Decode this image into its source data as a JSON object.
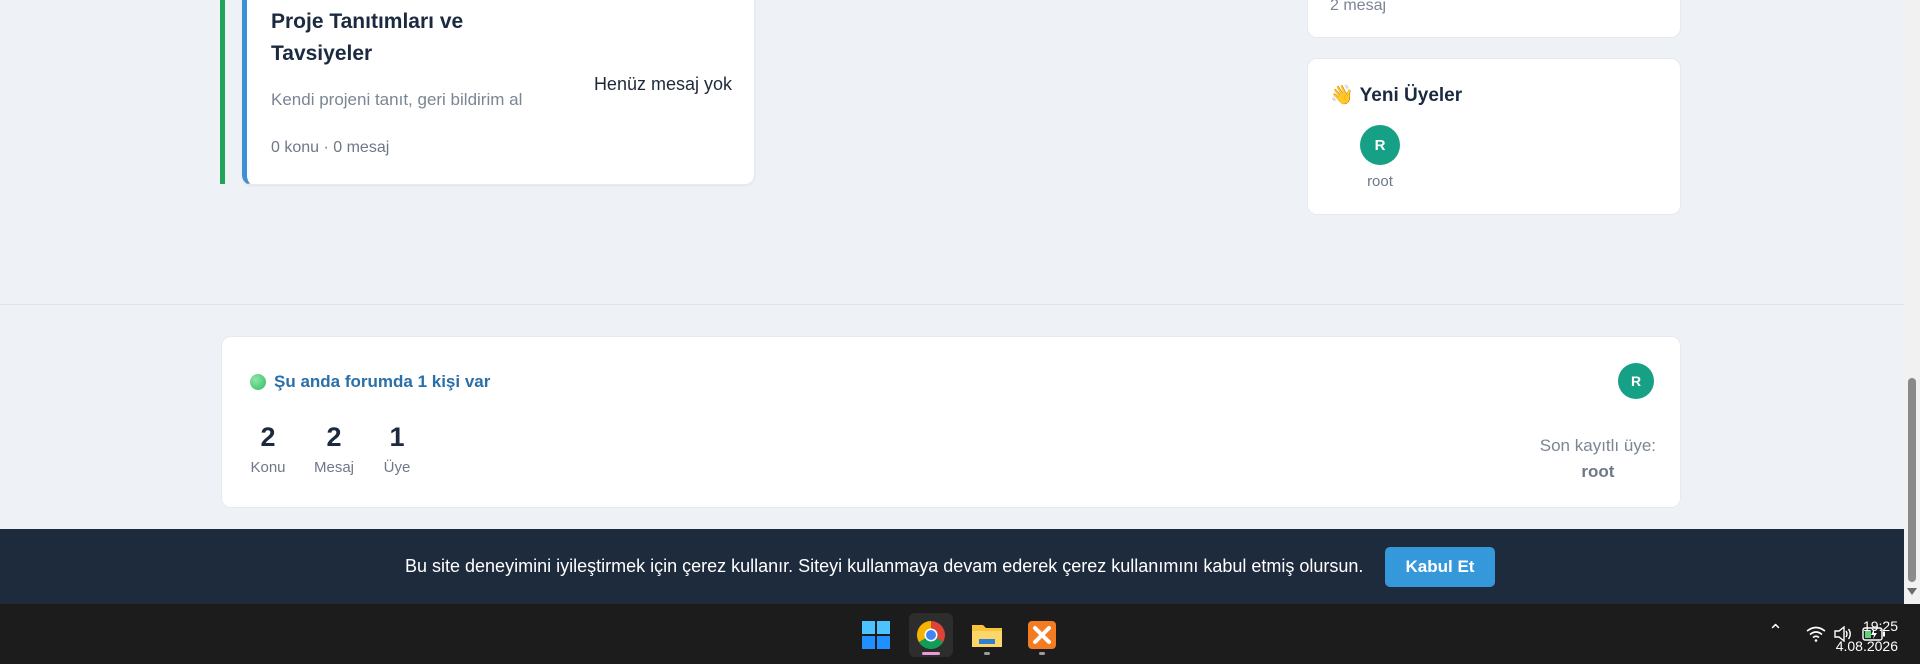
{
  "forum": {
    "title": "Proje Tanıtımları ve Tavsiyeler",
    "description": "Kendi projeni tanıt, geri bildirim al",
    "stats": "0 konu · 0 mesaj",
    "last_message": "Henüz mesaj yok"
  },
  "sidebar": {
    "top_card_text": "2 mesaj",
    "new_members": {
      "title": "Yeni Üyeler",
      "icon": "waving-hand-icon",
      "members": [
        {
          "initial": "R",
          "name": "root"
        }
      ]
    }
  },
  "online": {
    "title": "Şu anda forumda 1 kişi var",
    "stats": [
      {
        "value": "2",
        "label": "Konu"
      },
      {
        "value": "2",
        "label": "Mesaj"
      },
      {
        "value": "1",
        "label": "Üye"
      }
    ],
    "avatar_initial": "R",
    "last_member_label": "Son kayıtlı üye:",
    "last_member_name": "root"
  },
  "cookie": {
    "text": "Bu site deneyimini iyileştirmek için çerez kullanır. Siteyi kullanmaya devam ederek çerez kullanımını kabul etmiş olursun.",
    "button": "Kabul Et"
  },
  "taskbar": {
    "time": "19:25",
    "date": "4.08.2026"
  },
  "colors": {
    "accent": "#3498db",
    "forum_border": "#3d8fd6",
    "category_bar": "#22a35a",
    "avatar": "#16a085",
    "cookie_bg": "#1d2b3d"
  }
}
